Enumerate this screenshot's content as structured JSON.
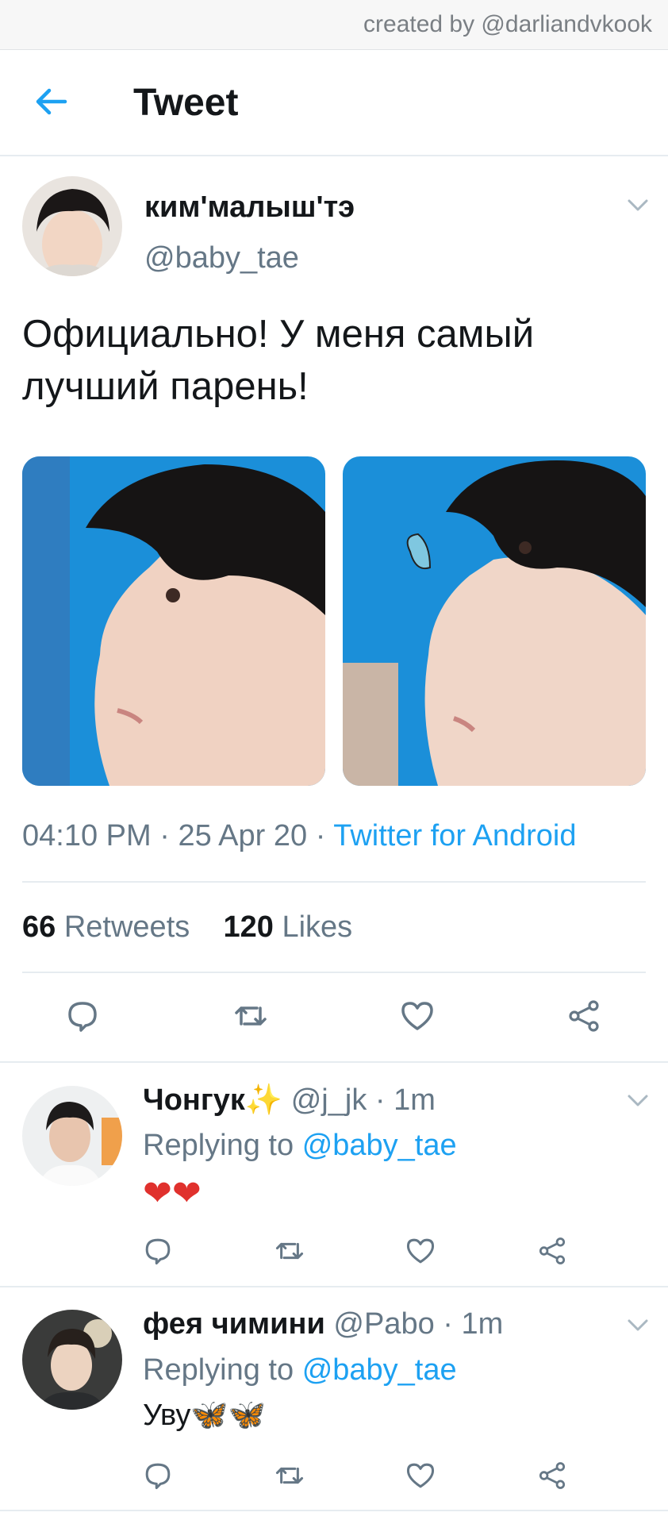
{
  "credit": "created by @darliandvkook",
  "header": {
    "title": "Tweet"
  },
  "tweet": {
    "name": "ким'малыш'тэ",
    "handle": "@baby_tae",
    "text": "Официально! У меня самый лучший парень!",
    "time": "04:10 PM",
    "date": "25 Apr 20",
    "source": "Twitter for Android",
    "retweets": "66",
    "retweets_label": "Retweets",
    "likes": "120",
    "likes_label": "Likes"
  },
  "replies": [
    {
      "name": "Чонгук✨",
      "handle": "@j_jk",
      "time": "1m",
      "replying_label": "Replying to",
      "replying_to": "@baby_tae",
      "text": "❤❤"
    },
    {
      "name": "фея чимини",
      "handle": "@Pabo",
      "time": "1m",
      "replying_label": "Replying to",
      "replying_to": "@baby_tae",
      "text": "Уву🦋🦋"
    }
  ],
  "colors": {
    "accent": "#1da1f2",
    "muted": "#657786",
    "divider": "#e6ecf0"
  },
  "icons": [
    "back-arrow-icon",
    "chevron-down-icon",
    "reply-icon",
    "retweet-icon",
    "like-icon",
    "share-icon"
  ]
}
